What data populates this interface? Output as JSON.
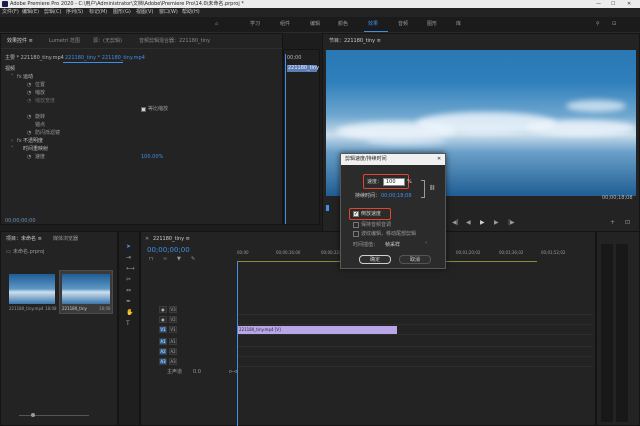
{
  "title_bar": {
    "title": "Adobe Premiere Pro 2020 - C:\\用户\\Administrator\\文档\\Adobe\\Premiere Pro\\14.0\\未命名.prproj *",
    "minimize": "—",
    "maximize": "☐",
    "close": "✕"
  },
  "menu": [
    "文件(F)",
    "编辑(E)",
    "剪辑(C)",
    "序列(S)",
    "标记(M)",
    "图形(G)",
    "视图(V)",
    "窗口(W)",
    "帮助(H)"
  ],
  "workspaces": [
    "学习",
    "组件",
    "编辑",
    "颜色",
    "效果",
    "音频",
    "图形",
    "库"
  ],
  "workspace_active_index": 4,
  "effect_controls": {
    "tabs": [
      "效果控件 ≡",
      "Lumetri 范围",
      "源：(无剪辑)",
      "音频剪辑混合器：221180_tiny"
    ],
    "master_label": "主要 * 221180_tiny.mp4",
    "clip_label": "221180_tiny * 221180_tiny.mp4",
    "section_video": "视频",
    "fx_motion": "运动",
    "prop_position": "位置",
    "prop_scale": "缩放",
    "prop_scale_width": "缩放宽度",
    "uniform_scale": "等比缩放",
    "prop_rotation": "旋转",
    "prop_anchor": "锚点",
    "prop_antiflicker": "防闪烁滤镜",
    "fx_opacity": "不透明度",
    "fx_timeremap": "时间重映射",
    "prop_speed": "速度",
    "speed_value": "100.00%",
    "timecode": "00;00;00;00",
    "src_timecode": "00;00",
    "src_clip": "221180_tiny"
  },
  "program": {
    "tab": "节目：221180_tiny ≡",
    "timecode_end": "00;00;18;08",
    "fit": "完整"
  },
  "project": {
    "tabs": [
      "项目：未命名 ≡",
      "媒体浏览器"
    ],
    "folder": "未命名.prproj",
    "items": [
      {
        "name": "221180_tiny.mp4",
        "duration": "18;08"
      },
      {
        "name": "221180_tiny",
        "duration": "18;08"
      }
    ]
  },
  "timeline": {
    "tab": "221180_tiny ≡",
    "timecode": "00;00;00;00",
    "ruler": [
      "00;00",
      "00;00;16;00",
      "00;00;32;00",
      "00;00;48;00",
      "00;01;04;02",
      "00;01;20;02",
      "00;01;36;02",
      "00;01;52;02"
    ],
    "video_tracks": [
      "V3",
      "V2",
      "V1"
    ],
    "audio_tracks": [
      "A1",
      "A2",
      "A3"
    ],
    "master": "主声道",
    "master_value": "0.0",
    "clip": "221180_tiny.mp4 [V]"
  },
  "dialog": {
    "title": "剪辑速度/持续时间",
    "speed_label": "速度：",
    "speed_value": "100",
    "percent": "%",
    "duration_label": "持续时间：",
    "duration_value": "00;00;18;08",
    "reverse": "倒放速度",
    "keep_pitch": "保持音频音调",
    "ripple": "波纹编辑，移动尾部剪辑",
    "interp_label": "时间插值：",
    "interp_value": "帧采样",
    "ok": "确定",
    "cancel": "取消"
  },
  "colors": {
    "accent": "#3f8fe8",
    "highlight": "#e2452a",
    "clip": "#b9a6e6"
  }
}
